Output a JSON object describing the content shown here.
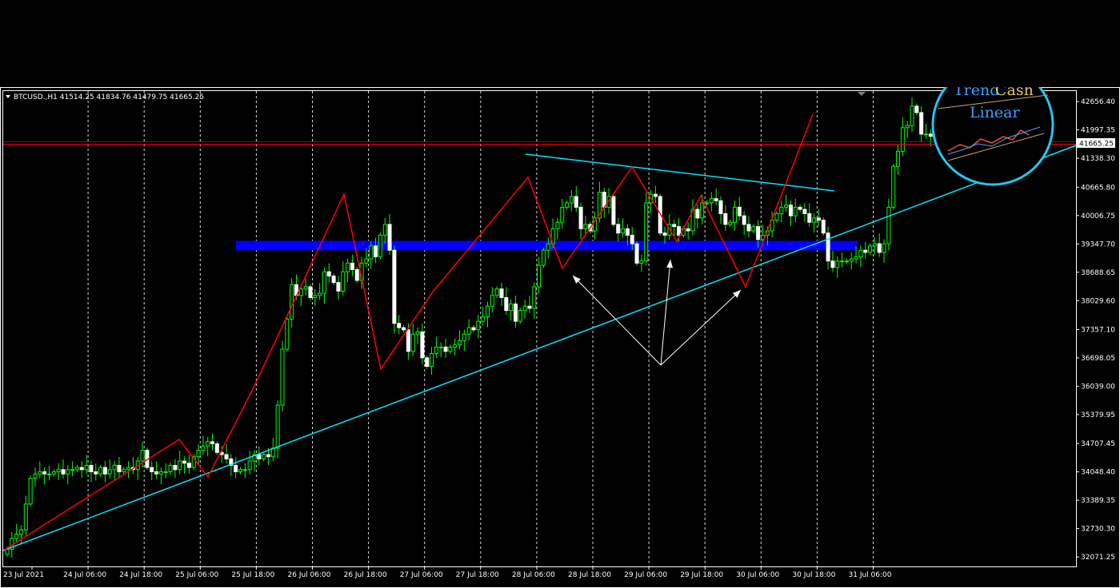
{
  "colors": {
    "background": "#000000",
    "bull_candle": "#00ff00",
    "bear_candle": "#ffffff",
    "grid": "#ffffff",
    "zigzag": "#ff0000",
    "trendline": "#00e5ff",
    "zone": "#0000ff",
    "price_line": "#ff0000",
    "arrows": "#ffffff",
    "logo_ring": "#1ec8f0",
    "logo_trend": "#3aa0ff",
    "logo_cash": "#e8c56a"
  },
  "header": {
    "symbol_text": "BTCUSD.,H1  41514.25 41834.76 41479.75 41665.25"
  },
  "current_price": {
    "label": "41665.25",
    "value": 41665.25
  },
  "logo": {
    "word1": "Trend",
    "word2": "Cash",
    "word3": "Linear"
  },
  "chart_data": {
    "type": "candlestick",
    "symbol": "BTCUSD.",
    "timeframe": "H1",
    "ohlc_header": {
      "open": 41514.25,
      "high": 41834.76,
      "low": 41479.75,
      "close": 41665.25
    },
    "ylim": [
      31850,
      42900
    ],
    "y_ticks": [
      "42656.40",
      "41997.35",
      "41338.30",
      "40665.80",
      "40006.75",
      "39347.70",
      "38688.65",
      "38029.60",
      "37357.10",
      "36698.05",
      "36039.00",
      "35379.95",
      "34707.45",
      "34048.40",
      "33389.35",
      "32730.30",
      "32071.25"
    ],
    "x_ticks": [
      "23 Jul 2021",
      "24 Jul 06:00",
      "24 Jul 18:00",
      "25 Jul 06:00",
      "25 Jul 18:00",
      "26 Jul 06:00",
      "26 Jul 18:00",
      "27 Jul 06:00",
      "27 Jul 18:00",
      "28 Jul 06:00",
      "28 Jul 18:00",
      "29 Jul 06:00",
      "29 Jul 18:00",
      "30 Jul 06:00",
      "30 Jul 18:00",
      "31 Jul 06:00"
    ],
    "grid": "vertical dashed every 12 hours",
    "candles_close": [
      32250,
      32500,
      32600,
      32700,
      33300,
      33900,
      34000,
      34050,
      34000,
      34000,
      34050,
      34100,
      34000,
      34100,
      34100,
      34150,
      34100,
      34200,
      34050,
      34000,
      34150,
      34000,
      34100,
      34200,
      34050,
      34100,
      34150,
      34100,
      34300,
      34550,
      34150,
      34050,
      34000,
      34050,
      34050,
      34200,
      34100,
      34300,
      34250,
      34150,
      34400,
      34550,
      34650,
      34750,
      34700,
      34500,
      34450,
      34350,
      34200,
      34050,
      34100,
      34100,
      34300,
      34450,
      34350,
      34450,
      34400,
      34600,
      35600,
      36900,
      37600,
      38400,
      38150,
      38300,
      38350,
      38100,
      38150,
      38200,
      38700,
      38600,
      38450,
      38250,
      38700,
      38900,
      38750,
      38500,
      38900,
      39000,
      39300,
      39050,
      39550,
      39800,
      39200,
      37500,
      37400,
      37350,
      36850,
      37250,
      37300,
      36700,
      36500,
      36800,
      36950,
      36950,
      36850,
      36950,
      37000,
      37100,
      37250,
      37400,
      37350,
      37550,
      37650,
      37900,
      38150,
      38300,
      38100,
      37800,
      37950,
      37550,
      37800,
      37900,
      37850,
      38350,
      38850,
      39200,
      39350,
      39700,
      39850,
      40200,
      40300,
      40450,
      40200,
      39700,
      39800,
      39650,
      39950,
      40550,
      40200,
      40450,
      39800,
      39600,
      39700,
      39550,
      39350,
      38900,
      38950,
      40300,
      40500,
      40450,
      39600,
      39550,
      39800,
      39750,
      39550,
      39700,
      39650,
      40150,
      39950,
      40300,
      40300,
      40400,
      40350,
      40050,
      39800,
      39850,
      40200,
      40000,
      39800,
      39650,
      39750,
      39450,
      39550,
      39650,
      39900,
      40050,
      40200,
      40250,
      40000,
      40200,
      40150,
      40050,
      39850,
      39950,
      39900,
      39600,
      38950,
      38800,
      38950,
      38950,
      38950,
      39000,
      39050,
      39200,
      39150,
      39300,
      39350,
      39150,
      39350,
      40200,
      41150,
      41500,
      42050,
      42100,
      42550,
      42400,
      41900,
      41900,
      41850,
      41850,
      41700,
      41750,
      41500,
      41700,
      41750,
      41665
    ],
    "zigzag": [
      [
        0,
        32150
      ],
      [
        31,
        34850
      ],
      [
        36,
        34050
      ],
      [
        60,
        38300
      ],
      [
        60,
        38300
      ],
      [
        118,
        40500
      ],
      [
        118,
        40500
      ],
      [
        140,
        38950
      ],
      [
        140,
        38950
      ],
      [
        131,
        40550
      ]
    ],
    "pattern_note": ""
  }
}
